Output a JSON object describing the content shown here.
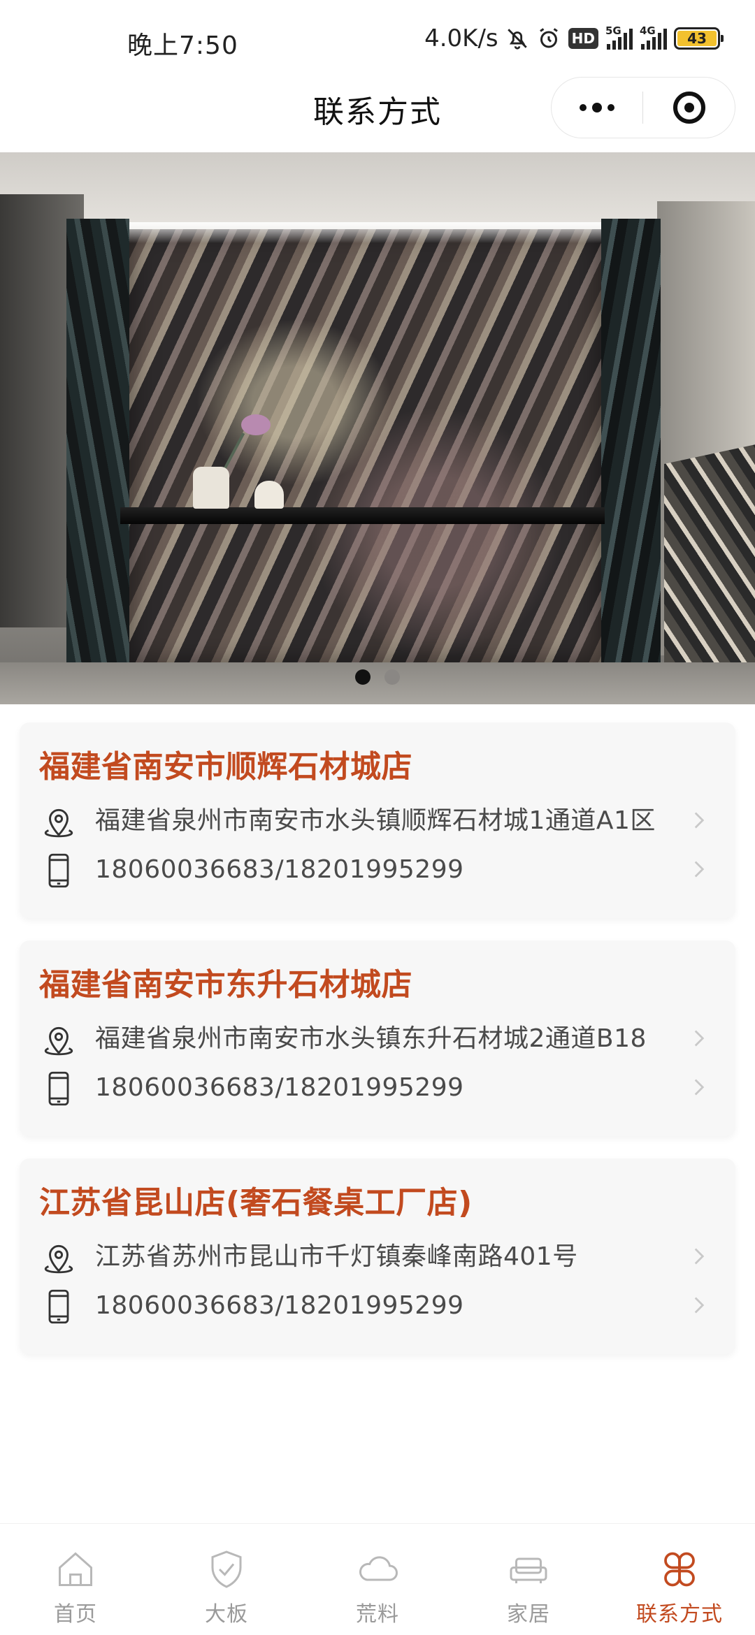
{
  "status_bar": {
    "time": "晚上7:50",
    "network_speed": "4.0K/s",
    "hd_badge": "HD",
    "signal_1_label": "5G",
    "signal_2_label": "4G",
    "battery": "43",
    "battery_color": "#f2c12e"
  },
  "header": {
    "title": "联系方式",
    "more_icon": "more-dots-icon",
    "close_icon": "target-circle-icon"
  },
  "banner": {
    "image_description_icon": "marble-wall-photo",
    "slide_count": 2,
    "active_slide": 1
  },
  "stores": [
    {
      "name": "福建省南安市顺辉石材城店",
      "address": "福建省泉州市南安市水头镇顺辉石材城1通道A1区",
      "phone": "18060036683/18201995299"
    },
    {
      "name": "福建省南安市东升石材城店",
      "address": "福建省泉州市南安市水头镇东升石材城2通道B18",
      "phone": "18060036683/18201995299"
    },
    {
      "name": "江苏省昆山店(奢石餐桌工厂店)",
      "address": "江苏省苏州市昆山市千灯镇秦峰南路401号",
      "phone": "18060036683/18201995299"
    }
  ],
  "colors": {
    "accent": "#c24a1f",
    "inactive_nav": "#9a9a9a"
  },
  "bottom_nav": [
    {
      "label": "首页",
      "icon": "home-icon",
      "active": false
    },
    {
      "label": "大板",
      "icon": "shield-check-icon",
      "active": false
    },
    {
      "label": "荒料",
      "icon": "cloud-icon",
      "active": false
    },
    {
      "label": "家居",
      "icon": "sofa-icon",
      "active": false
    },
    {
      "label": "联系方式",
      "icon": "four-petal-icon",
      "active": true
    }
  ]
}
